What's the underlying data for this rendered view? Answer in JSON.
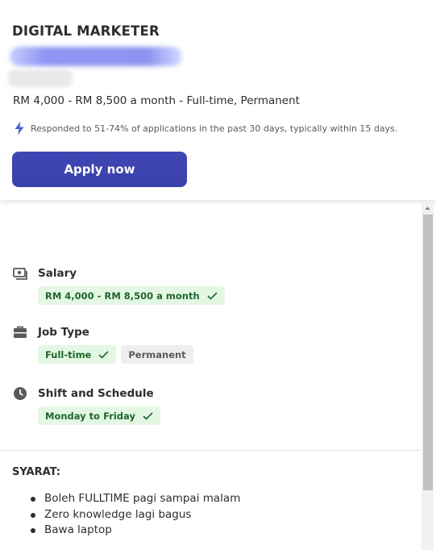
{
  "job": {
    "title": "DIGITAL MARKETER",
    "salary_line": "RM 4,000 - RM 8,500 a month  - Full-time, Permanent",
    "response_note": "Responded to 51-74% of applications in the past 30 days, typically within 15 days.",
    "apply_label": "Apply now"
  },
  "details": {
    "salary": {
      "label": "Salary",
      "icon": "money-icon",
      "pills": [
        "RM 4,000 - RM 8,500 a month"
      ]
    },
    "job_type": {
      "label": "Job Type",
      "icon": "briefcase-icon",
      "pills": [
        "Full-time",
        "Permanent"
      ]
    },
    "shift": {
      "label": "Shift and Schedule",
      "icon": "clock-icon",
      "pills": [
        "Monday to Friday"
      ]
    }
  },
  "description": {
    "heading": "SYARAT:",
    "requirements": [
      "Boleh FULLTIME pagi sampai malam",
      "Zero knowledge lagi bagus",
      "Bawa laptop"
    ]
  },
  "colors": {
    "apply_button": "#3f46b2",
    "pill_green_bg": "#e4f7e4",
    "pill_green_text": "#1f662c",
    "pill_grey_bg": "#eeeeee",
    "lightning": "#4f5bd5"
  }
}
